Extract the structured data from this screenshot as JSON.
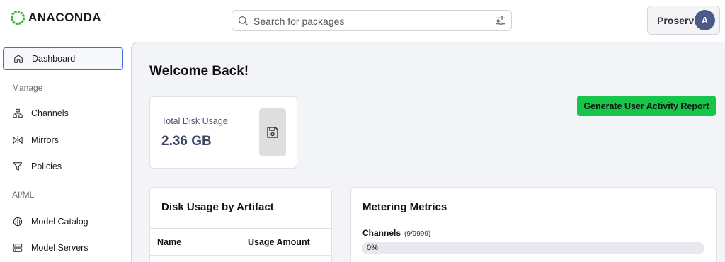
{
  "header": {
    "logo_text": "ANACONDA",
    "logo_tm": ".",
    "search": {
      "placeholder": "Search for packages"
    },
    "user": {
      "name": "Proserv",
      "avatar_initial": "A"
    }
  },
  "sidebar": {
    "items": [
      {
        "label": "Dashboard",
        "icon": "home-icon",
        "active": true
      }
    ],
    "sections": [
      {
        "label": "Manage",
        "items": [
          {
            "label": "Channels",
            "icon": "channels-icon"
          },
          {
            "label": "Mirrors",
            "icon": "mirrors-icon"
          },
          {
            "label": "Policies",
            "icon": "filter-funnel-icon"
          }
        ]
      },
      {
        "label": "AI/ML",
        "items": [
          {
            "label": "Model Catalog",
            "icon": "brain-icon"
          },
          {
            "label": "Model Servers",
            "icon": "server-icon"
          }
        ]
      }
    ]
  },
  "main": {
    "welcome": "Welcome Back!",
    "disk_usage": {
      "label": "Total Disk Usage",
      "value": "2.36 GB",
      "icon": "save-disk-icon"
    },
    "report_button": "Generate User Activity Report",
    "artifact_card": {
      "title": "Disk Usage by Artifact",
      "columns": [
        "Name",
        "Usage Amount"
      ]
    },
    "metering_card": {
      "title": "Metering Metrics",
      "metrics": [
        {
          "name": "Channels",
          "count": "(9/9999)",
          "progress_label": "0%",
          "progress_fraction": 0.0
        }
      ]
    }
  },
  "colors": {
    "accent_green": "#16c54a",
    "active_border": "#3b6fd8",
    "avatar_bg": "#4c5a8a",
    "logo_green": "#3fb43b"
  }
}
